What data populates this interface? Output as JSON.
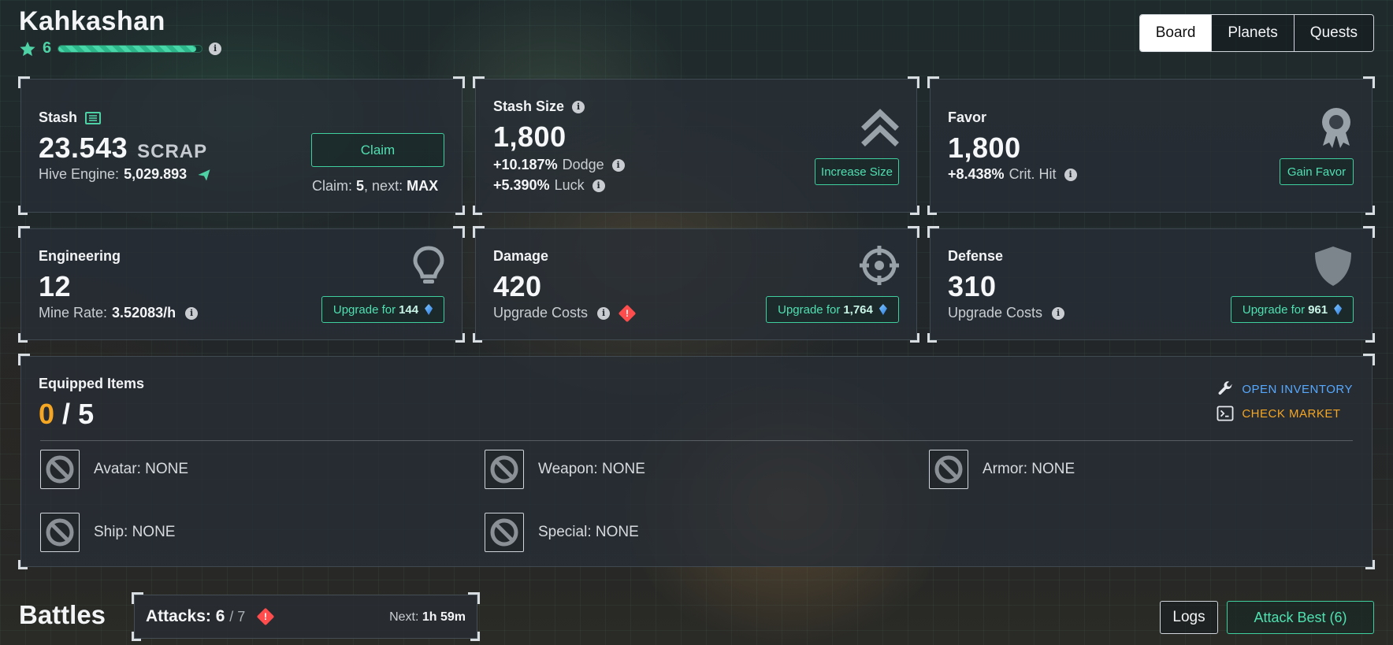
{
  "header": {
    "title": "Kahkashan",
    "level": "6",
    "xp_progress": 0.96
  },
  "tabs": [
    {
      "label": "Board",
      "active": true
    },
    {
      "label": "Planets",
      "active": false
    },
    {
      "label": "Quests",
      "active": false
    }
  ],
  "stash": {
    "label": "Stash",
    "value": "23.543",
    "unit": "SCRAP",
    "hive_label": "Hive Engine:",
    "hive_value": "5,029.893",
    "claim_button": "Claim",
    "claim_info_label": "Claim:",
    "claim_count": "5",
    "next_label": ", next:",
    "next_value": "MAX"
  },
  "stash_size": {
    "label": "Stash Size",
    "value": "1,800",
    "dodge_value": "+10.187%",
    "dodge_label": "Dodge",
    "luck_value": "+5.390%",
    "luck_label": "Luck",
    "button": "Increase Size"
  },
  "favor": {
    "label": "Favor",
    "value": "1,800",
    "crit_value": "+8.438%",
    "crit_label": "Crit. Hit",
    "button": "Gain Favor"
  },
  "engineering": {
    "label": "Engineering",
    "value": "12",
    "mine_label": "Mine Rate:",
    "mine_value": "3.52083/h",
    "button_label": "Upgrade for",
    "button_cost": "144"
  },
  "damage": {
    "label": "Damage",
    "value": "420",
    "costs_label": "Upgrade Costs",
    "button_label": "Upgrade for",
    "button_cost": "1,764"
  },
  "defense": {
    "label": "Defense",
    "value": "310",
    "costs_label": "Upgrade Costs",
    "button_label": "Upgrade for",
    "button_cost": "961"
  },
  "equipped": {
    "label": "Equipped Items",
    "count": "0",
    "separator": "/",
    "total": "5",
    "open_inventory": "OPEN INVENTORY",
    "check_market": "CHECK MARKET",
    "slots": [
      {
        "label": "Avatar: NONE"
      },
      {
        "label": "Weapon: NONE"
      },
      {
        "label": "Armor: NONE"
      },
      {
        "label": "Ship: NONE"
      },
      {
        "label": "Special: NONE"
      }
    ]
  },
  "battles": {
    "title": "Battles",
    "attacks_label": "Attacks:",
    "attacks_value": "6",
    "attacks_max": "/ 7",
    "next_label": "Next:",
    "next_value": "1h 59m",
    "logs_button": "Logs",
    "attack_best_button": "Attack Best (6)"
  },
  "colors": {
    "accent": "#4fd1a6",
    "warning": "#ff4d4d",
    "link_blue": "#57a9ff",
    "link_orange": "#f5a623"
  }
}
